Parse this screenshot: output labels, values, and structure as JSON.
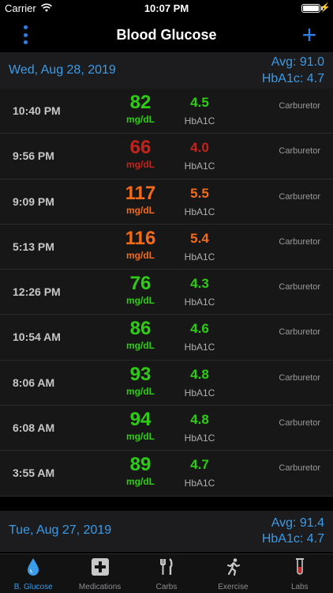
{
  "status": {
    "carrier": "Carrier",
    "time": "10:07 PM"
  },
  "nav": {
    "title": "Blood Glucose",
    "add_label": "+"
  },
  "sections": [
    {
      "date": "Wed, Aug 28, 2019",
      "avg": "Avg: 91.0",
      "hba1c": "HbA1c: 4.7"
    },
    {
      "date": "Tue, Aug 27, 2019",
      "avg": "Avg: 91.4",
      "hba1c": "HbA1c: 4.7"
    }
  ],
  "colors": {
    "green": "#2ecc14",
    "red": "#c4231b",
    "orange": "#f36b1a",
    "accent": "#3a9be8"
  },
  "rows": [
    {
      "time": "10:40 PM",
      "glucose": "82",
      "unit": "mg/dL",
      "hba": "4.5",
      "hba_label": "HbA1C",
      "device": "Carburetor",
      "level": "green"
    },
    {
      "time": "9:56 PM",
      "glucose": "66",
      "unit": "mg/dL",
      "hba": "4.0",
      "hba_label": "HbA1C",
      "device": "Carburetor",
      "level": "red"
    },
    {
      "time": "9:09 PM",
      "glucose": "117",
      "unit": "mg/dL",
      "hba": "5.5",
      "hba_label": "HbA1C",
      "device": "Carburetor",
      "level": "orange"
    },
    {
      "time": "5:13 PM",
      "glucose": "116",
      "unit": "mg/dL",
      "hba": "5.4",
      "hba_label": "HbA1C",
      "device": "Carburetor",
      "level": "orange"
    },
    {
      "time": "12:26 PM",
      "glucose": "76",
      "unit": "mg/dL",
      "hba": "4.3",
      "hba_label": "HbA1C",
      "device": "Carburetor",
      "level": "green"
    },
    {
      "time": "10:54 AM",
      "glucose": "86",
      "unit": "mg/dL",
      "hba": "4.6",
      "hba_label": "HbA1C",
      "device": "Carburetor",
      "level": "green"
    },
    {
      "time": "8:06 AM",
      "glucose": "93",
      "unit": "mg/dL",
      "hba": "4.8",
      "hba_label": "HbA1C",
      "device": "Carburetor",
      "level": "green"
    },
    {
      "time": "6:08 AM",
      "glucose": "94",
      "unit": "mg/dL",
      "hba": "4.8",
      "hba_label": "HbA1C",
      "device": "Carburetor",
      "level": "green"
    },
    {
      "time": "3:55 AM",
      "glucose": "89",
      "unit": "mg/dL",
      "hba": "4.7",
      "hba_label": "HbA1C",
      "device": "Carburetor",
      "level": "green"
    }
  ],
  "tabs": [
    {
      "label": "B. Glucose",
      "icon": "blood-drop-icon",
      "active": true
    },
    {
      "label": "Medications",
      "icon": "medical-cross-icon",
      "active": false
    },
    {
      "label": "Carbs",
      "icon": "fork-knife-icon",
      "active": false
    },
    {
      "label": "Exercise",
      "icon": "runner-icon",
      "active": false
    },
    {
      "label": "Labs",
      "icon": "test-tube-icon",
      "active": false
    }
  ]
}
